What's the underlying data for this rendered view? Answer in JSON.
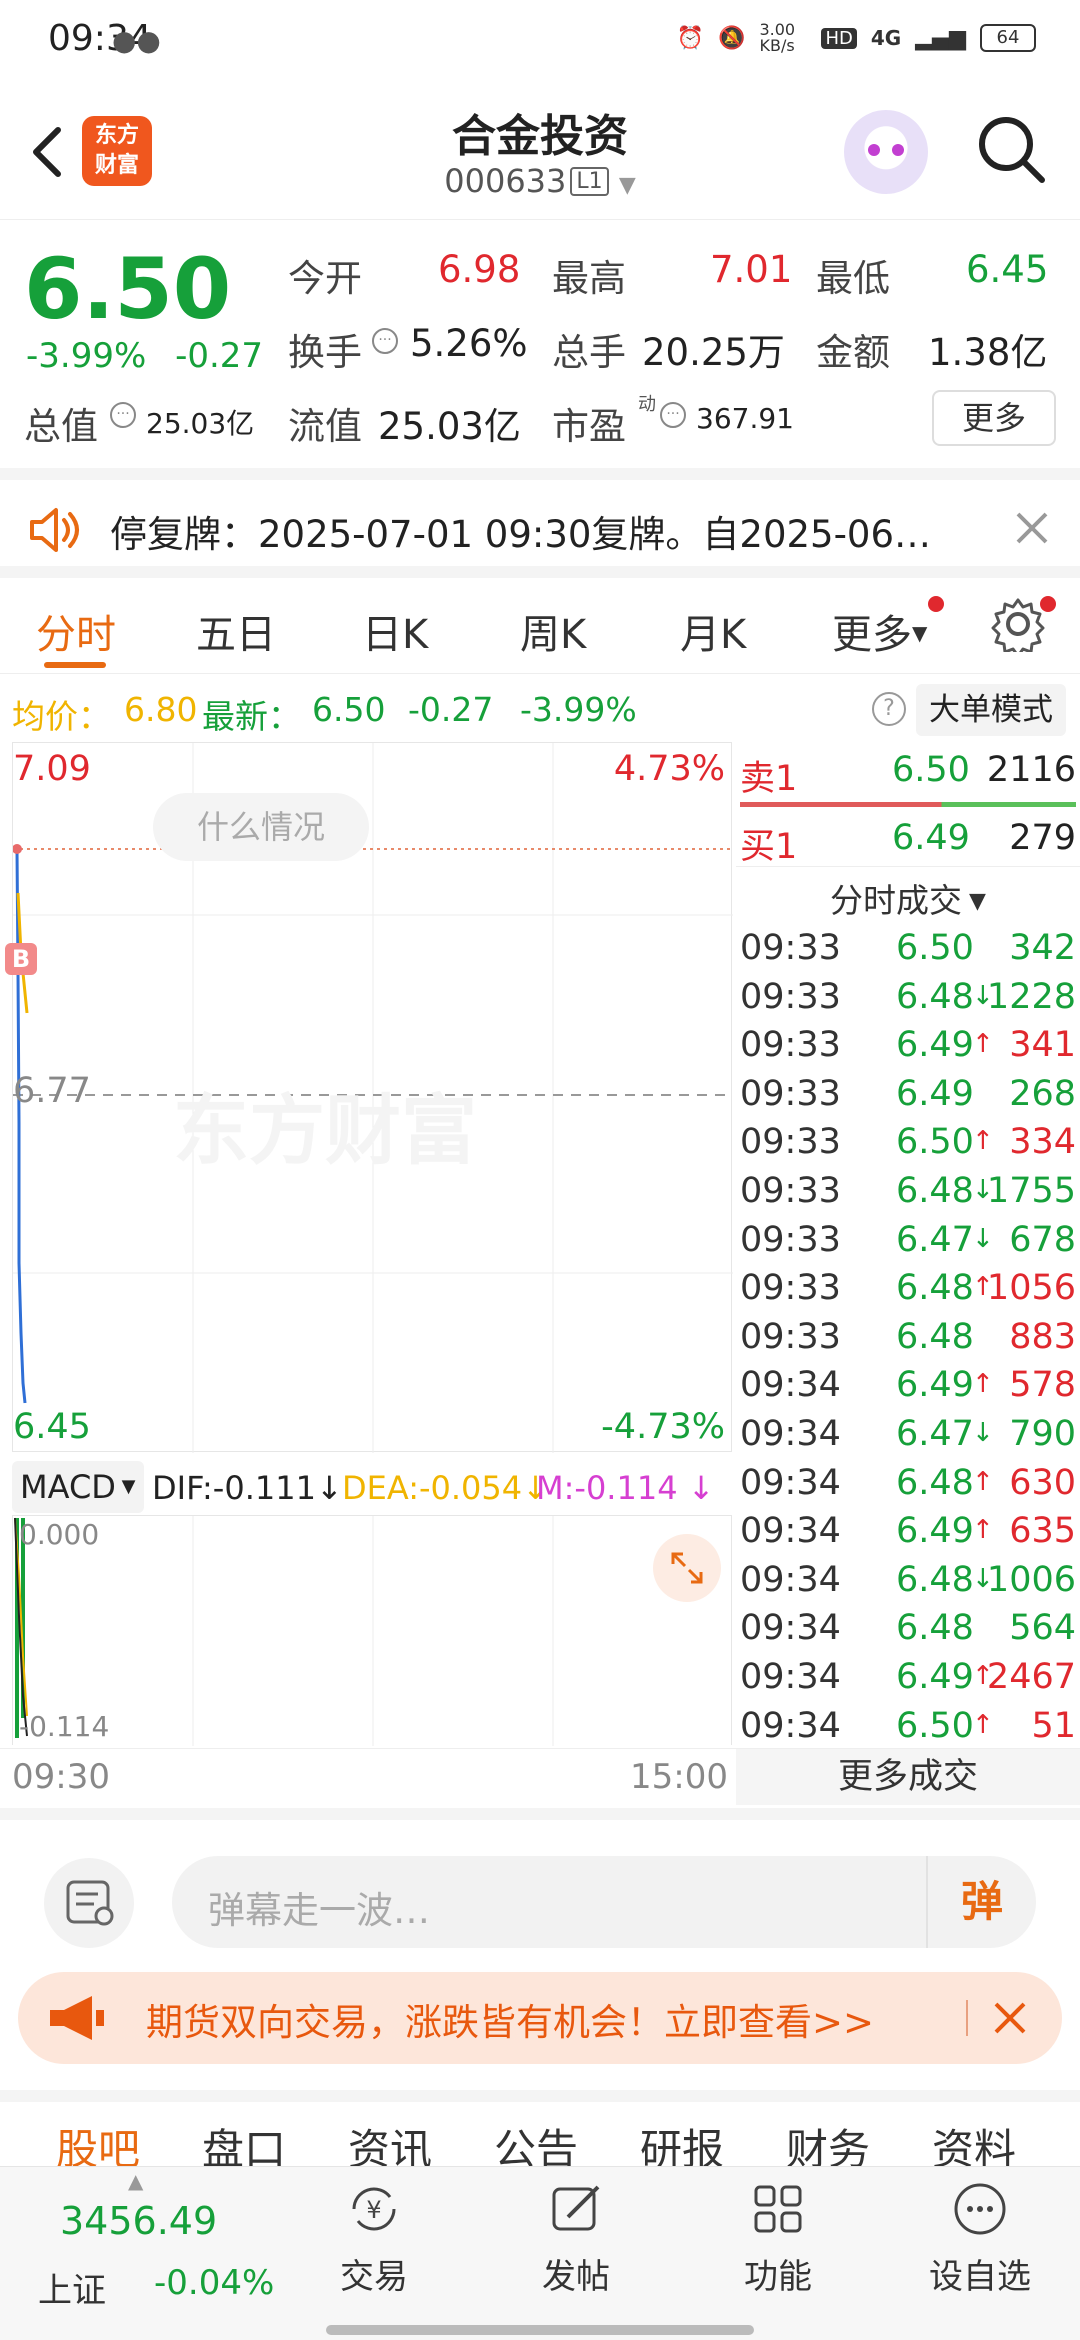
{
  "status_bar": {
    "time": "09:34",
    "net_speed": "3.00 KB/s",
    "signal": "4G",
    "battery": "64"
  },
  "header": {
    "logo_line1": "东方",
    "logo_line2": "财富",
    "title": "合金投资",
    "code": "000633",
    "level": "L1"
  },
  "quote": {
    "price": "6.50",
    "change_pct": "-3.99%",
    "change": "-0.27",
    "open_label": "今开",
    "open": "6.98",
    "high_label": "最高",
    "high": "7.01",
    "low_label": "最低",
    "low": "6.45",
    "turnover_label": "换手",
    "turnover": "5.26%",
    "volume_label": "总手",
    "volume": "20.25万",
    "amount_label": "金额",
    "amount": "1.38亿",
    "mktcap_label": "总值",
    "mktcap": "25.03亿",
    "float_label": "流值",
    "float_cap": "25.03亿",
    "pe_label": "市盈",
    "pe_sup": "动",
    "pe": "367.91",
    "more_label": "更多"
  },
  "notice": {
    "text": "停复牌：2025-07-01 09:30复牌。自2025-06…"
  },
  "tabs": [
    "分时",
    "五日",
    "日K",
    "周K",
    "月K",
    "更多"
  ],
  "summary": {
    "avg_label": "均价：",
    "avg": "6.80",
    "latest_label": "最新：",
    "latest": "6.50",
    "change": "-0.27",
    "change_pct": "-3.99%",
    "mode_button": "大单模式"
  },
  "chart": {
    "y_top": "7.09",
    "y_top_pct": "4.73%",
    "y_mid": "6.77",
    "y_bottom": "6.45",
    "y_bottom_pct": "-4.73%",
    "bubble": "什么情况",
    "marker": "B",
    "watermark": "东方财富",
    "x_start": "09:30",
    "x_end": "15:00"
  },
  "macd": {
    "selector": "MACD",
    "dif": "DIF:-0.111",
    "dea": "DEA:-0.054",
    "m": "M:-0.114",
    "top": "0.000",
    "bottom": "-0.114"
  },
  "order_book": {
    "sell1_label": "卖1",
    "sell1_price": "6.50",
    "sell1_vol": "2116",
    "buy1_label": "买1",
    "buy1_price": "6.49",
    "buy1_vol": "279"
  },
  "trades_title": "分时成交",
  "trades": [
    {
      "time": "09:33",
      "price": "6.50",
      "dir": "",
      "vol": "342",
      "color": "#16a03a"
    },
    {
      "time": "09:33",
      "price": "6.48",
      "dir": "↓",
      "vol": "1228",
      "color": "#16a03a"
    },
    {
      "time": "09:33",
      "price": "6.49",
      "dir": "↑",
      "vol": "341",
      "color": "#e0282e"
    },
    {
      "time": "09:33",
      "price": "6.49",
      "dir": "",
      "vol": "268",
      "color": "#16a03a"
    },
    {
      "time": "09:33",
      "price": "6.50",
      "dir": "↑",
      "vol": "334",
      "color": "#e0282e"
    },
    {
      "time": "09:33",
      "price": "6.48",
      "dir": "↓",
      "vol": "1755",
      "color": "#16a03a"
    },
    {
      "time": "09:33",
      "price": "6.47",
      "dir": "↓",
      "vol": "678",
      "color": "#16a03a"
    },
    {
      "time": "09:33",
      "price": "6.48",
      "dir": "↑",
      "vol": "1056",
      "color": "#e0282e"
    },
    {
      "time": "09:33",
      "price": "6.48",
      "dir": "",
      "vol": "883",
      "color": "#e0282e"
    },
    {
      "time": "09:34",
      "price": "6.49",
      "dir": "↑",
      "vol": "578",
      "color": "#e0282e"
    },
    {
      "time": "09:34",
      "price": "6.47",
      "dir": "↓",
      "vol": "790",
      "color": "#16a03a"
    },
    {
      "time": "09:34",
      "price": "6.48",
      "dir": "↑",
      "vol": "630",
      "color": "#e0282e"
    },
    {
      "time": "09:34",
      "price": "6.49",
      "dir": "↑",
      "vol": "635",
      "color": "#e0282e"
    },
    {
      "time": "09:34",
      "price": "6.48",
      "dir": "↓",
      "vol": "1006",
      "color": "#16a03a"
    },
    {
      "time": "09:34",
      "price": "6.48",
      "dir": "",
      "vol": "564",
      "color": "#16a03a"
    },
    {
      "time": "09:34",
      "price": "6.49",
      "dir": "↑",
      "vol": "2467",
      "color": "#e0282e"
    },
    {
      "time": "09:34",
      "price": "6.50",
      "dir": "↑",
      "vol": "51",
      "color": "#e0282e"
    }
  ],
  "more_trades": "更多成交",
  "comment": {
    "placeholder": "弹幕走一波…",
    "danmu_label": "弹"
  },
  "ad": {
    "text": "期货双向交易，涨跌皆有机会！立即查看>>"
  },
  "sub_tabs": [
    "股吧",
    "盘口",
    "资讯",
    "公告",
    "研报",
    "财务",
    "资料"
  ],
  "footer": {
    "index_value": "3456.49",
    "index_name": "上证",
    "index_change": "-0.04%",
    "nav": [
      "交易",
      "发帖",
      "功能",
      "设自选"
    ]
  },
  "colors": {
    "up": "#e0282e",
    "down": "#16a03a",
    "accent": "#e86a12",
    "avg_line": "#f0b400"
  }
}
